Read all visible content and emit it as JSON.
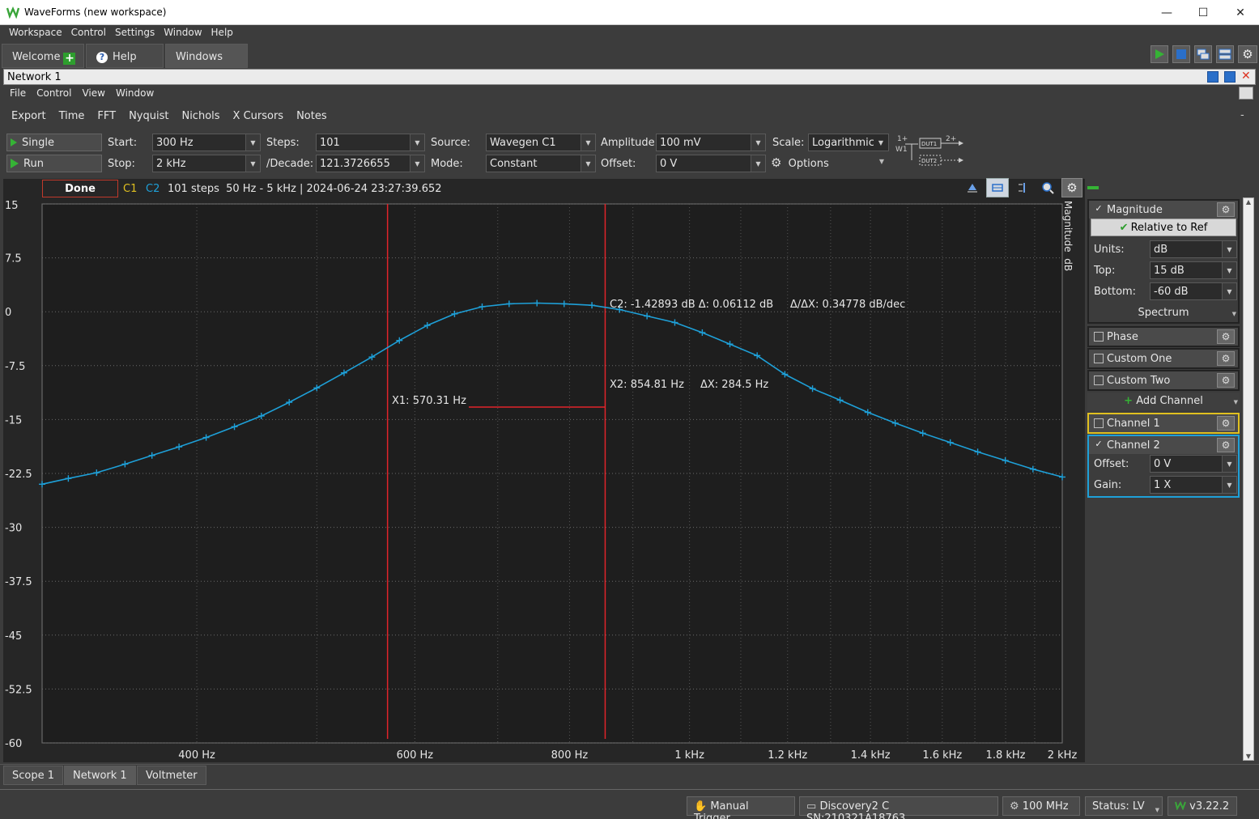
{
  "window": {
    "title": "WaveForms (new workspace)"
  },
  "main_menu": [
    "Workspace",
    "Control",
    "Settings",
    "Window",
    "Help"
  ],
  "top_tabs": {
    "welcome": "Welcome",
    "help": "Help",
    "windows": "Windows"
  },
  "network_window": {
    "title": "Network 1",
    "menu": [
      "File",
      "Control",
      "View",
      "Window"
    ],
    "toolbar": [
      "Export",
      "Time",
      "FFT",
      "Nyquist",
      "Nichols",
      "X Cursors",
      "Notes"
    ]
  },
  "controls": {
    "single_label": "Single",
    "run_label": "Run",
    "start_label": "Start:",
    "start_value": "300 Hz",
    "stop_label": "Stop:",
    "stop_value": "2 kHz",
    "steps_label": "Steps:",
    "steps_value": "101",
    "decade_label": "/Decade:",
    "decade_value": "121.3726655",
    "source_label": "Source:",
    "source_value": "Wavegen C1",
    "mode_label": "Mode:",
    "mode_value": "Constant",
    "amplitude_label": "Amplitude:",
    "amplitude_value": "100 mV",
    "offset_label": "Offset:",
    "offset_value": "0 V",
    "scale_label": "Scale:",
    "scale_value": "Logarithmic",
    "options_label": "Options",
    "diagram": {
      "in_plus": "1+",
      "in_w": "W1",
      "out_plus": "2+",
      "dut1": "DUT1",
      "dut2": "DUT2"
    }
  },
  "status_line": {
    "state": "Done",
    "c1": "C1",
    "c2": "C2",
    "info": "101 steps  50 Hz - 5 kHz | 2024-06-24 23:27:39.652"
  },
  "plot": {
    "y_axis_side_label": "Magnitude  dB",
    "y_ticks": [
      "15",
      "7.5",
      "0",
      "-7.5",
      "-15",
      "-22.5",
      "-30",
      "-37.5",
      "-45",
      "-52.5",
      "-60"
    ],
    "x_ticks": [
      "400 Hz",
      "600 Hz",
      "800 Hz",
      "1 kHz",
      "1.2 kHz",
      "1.4 kHz",
      "1.6 kHz",
      "1.8 kHz",
      "2 kHz"
    ],
    "cursor_c2_readout": "C2: -1.42893 dB Δ: 0.06112 dB     Δ/ΔX: 0.34778 dB/dec",
    "cursor_x1": "X1: 570.31 Hz",
    "cursor_x2": "X2: 854.81 Hz",
    "cursor_dx": "ΔX: 284.5 Hz",
    "trace_color": "#1ea0d8",
    "cursor_color": "#e0242a"
  },
  "chart_data": {
    "type": "line",
    "xscale": "log",
    "xlim": [
      300,
      2000
    ],
    "ylim": [
      -60,
      15
    ],
    "ylabel": "Magnitude  dB",
    "series": [
      {
        "name": "C2",
        "x": [
          300,
          315,
          332,
          350,
          368,
          387,
          407,
          429,
          451,
          475,
          500,
          526,
          554,
          583,
          614,
          646,
          680,
          715,
          753,
          792,
          834,
          878,
          924,
          973,
          1024,
          1078,
          1134,
          1194,
          1257,
          1323,
          1393,
          1466,
          1543,
          1624,
          1709,
          1799,
          1894,
          2000
        ],
        "y": [
          -24.0,
          -23.2,
          -22.4,
          -21.2,
          -20.0,
          -18.8,
          -17.5,
          -16.0,
          -14.5,
          -12.6,
          -10.6,
          -8.5,
          -6.3,
          -4.0,
          -1.9,
          -0.3,
          0.7,
          1.1,
          1.2,
          1.1,
          0.9,
          0.3,
          -0.6,
          -1.5,
          -2.9,
          -4.5,
          -6.1,
          -8.7,
          -10.7,
          -12.3,
          -14.0,
          -15.5,
          -16.9,
          -18.2,
          -19.5,
          -20.7,
          -21.9,
          -23.0
        ]
      }
    ],
    "cursors": {
      "x1": 570.31,
      "x2": 854.81,
      "dx": 284.5,
      "c2_value": -1.42893
    }
  },
  "right_panel": {
    "magnitude": {
      "label": "Magnitude",
      "relative_btn": "Relative to Ref",
      "units_label": "Units:",
      "units_value": "dB",
      "top_label": "Top:",
      "top_value": "15 dB",
      "bottom_label": "Bottom:",
      "bottom_value": "-60 dB",
      "spectrum": "Spectrum"
    },
    "phase": "Phase",
    "custom_one": "Custom One",
    "custom_two": "Custom Two",
    "add_channel": "Add Channel",
    "channel1": "Channel 1",
    "channel2": {
      "label": "Channel 2",
      "offset_label": "Offset:",
      "offset_value": "0 V",
      "gain_label": "Gain:",
      "gain_value": "1 X"
    },
    "channel1_color": "#e0c020",
    "channel2_color": "#1ea0d8"
  },
  "bottom_tabs": [
    "Scope 1",
    "Network 1",
    "Voltmeter"
  ],
  "status_bar": {
    "trigger": "Manual Trigger",
    "device": "Discovery2 C SN:210321A18763",
    "freq": "100 MHz",
    "status": "Status: LV",
    "version": "v3.22.2"
  }
}
